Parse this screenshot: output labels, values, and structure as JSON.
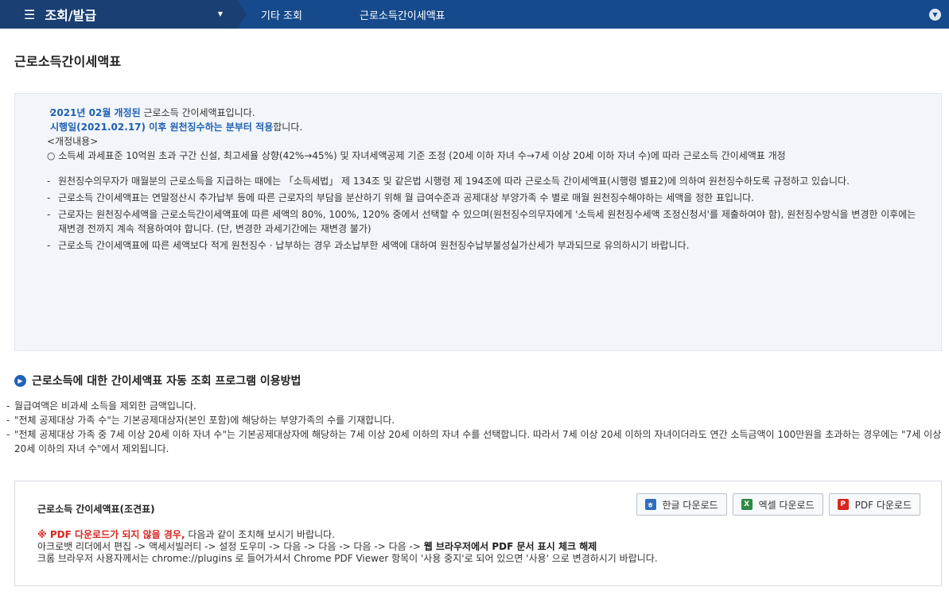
{
  "topbar": {
    "menu_icon": "☰",
    "menu_label": "조회/발급",
    "menu_caret": "▼",
    "crumb_1": "기타 조회",
    "crumb_2": "근로소득간이세액표",
    "right_icon": "chevron-down-icon",
    "right_glyph": "▼"
  },
  "page": {
    "title": "근로소득간이세액표"
  },
  "notice": {
    "bullet": "•",
    "line1_blue": "2021년 02월  개정된",
    "line1_rest": " 근로소득 간이세액표입니다.",
    "line2_blue": "시행일(2021.02.17) 이후 원천징수하는 분부터 적용",
    "line2_rest": "합니다.",
    "line3": "<개정내용>",
    "line4": "○ 소득세 과세표준 10억원 초과 구간 신설, 최고세율 상향(42%→45%) 및 자녀세액공제 기준 조정 (20세 이하 자녀 수→7세 이상 20세 이하 자녀 수)에 따라 근로소득 간이세액표 개정",
    "dash": "-",
    "items": [
      "원천징수의무자가 매월분의 근로소득을 지급하는 때에는 「소득세법」 제 134조 및 같은법 시행령 제 194조에 따라 근로소득 간이세액표(시행령 별표2)에 의하여 원천징수하도록 규정하고 있습니다.",
      "근로소득 간이세액표는 연말정산시 추가납부 등에 따른 근로자의 부담을 분산하기 위해 월 급여수준과 공제대상 부양가족 수 별로 매월 원천징수해야하는 세액을 정한 표입니다.",
      "근로자는 원천징수세액을 근로소득간이세액표에 따른 세액의 80%, 100%, 120% 중에서 선택할 수 있으며(원천징수의무자에게 '소득세 원천징수세액 조정신청서'를 제출하여야 함), 원천징수방식을 변경한 이후에는 재변경 전까지 계속 적용하여야 합니다. (단, 변경한 과세기간에는 재변경 불가)",
      "근로소득 간이세액표에 따른 세액보다 적게 원천징수 · 납부하는 경우 과소납부한 세액에 대하여 원천징수납부불성실가산세가 부과되므로 유의하시기 바랍니다."
    ]
  },
  "section": {
    "icon_glyph": "▶",
    "heading": "근로소득에 대한 간이세액표 자동 조회 프로그램 이용방법"
  },
  "info": {
    "dash": "-",
    "items": [
      "월급여액은  비과세 소득을 제외한 금액입니다.",
      "\"전체 공제대상 가족 수\"는 기본공제대상자(본인 포함)에 해당하는 부양가족의 수를 기재합니다.",
      "\"전체 공제대상 가족 중 7세 이상 20세 이하 자녀 수\"는 기본공제대상자에 해당하는 7세 이상 20세 이하의 자녀 수를 선택합니다. 따라서 7세 이상 20세 이하의 자녀이더라도 연간 소득금액이 100만원을 초과하는 경우에는 \"7세 이상 20세 이하의 자녀 수\"에서 제외됩니다."
    ]
  },
  "download": {
    "title": "근로소득 간이세액표(조견표)",
    "buttons": [
      {
        "label": "한글 다운로드",
        "icon": "hwp-file-icon",
        "glyph": "ㅎ"
      },
      {
        "label": "엑셀 다운로드",
        "icon": "excel-file-icon",
        "glyph": "X"
      },
      {
        "label": "PDF 다운로드",
        "icon": "pdf-file-icon",
        "glyph": "P"
      }
    ],
    "tip_red": "※ PDF 다운로드가 되지 않을 경우,",
    "tip_red_rest": " 다음과 같이 조치해 보시기 바랍니다.",
    "tip_line2_pre": "아크로뱃 리더에서 편집 -> 액세서빌러티 -> 설정 도우미 -> 다음 -> 다음 -> 다음 -> 다음 -> ",
    "tip_line2_bold": "웹 브라우저에서 PDF 문서 표시 체크 해제",
    "tip_line3": "크롬 브라우저 사용자께서는 chrome://plugins 로 들어가셔서 Chrome PDF Viewer 항목이 '사용 중지'로 되어 있으면 '사용' 으로 변경하시기 바랍니다."
  },
  "colors": {
    "nav": "#174a8c",
    "nav_dark": "#1a3f73",
    "accent_blue": "#1f5fb2",
    "alert_red": "#d7261e"
  }
}
